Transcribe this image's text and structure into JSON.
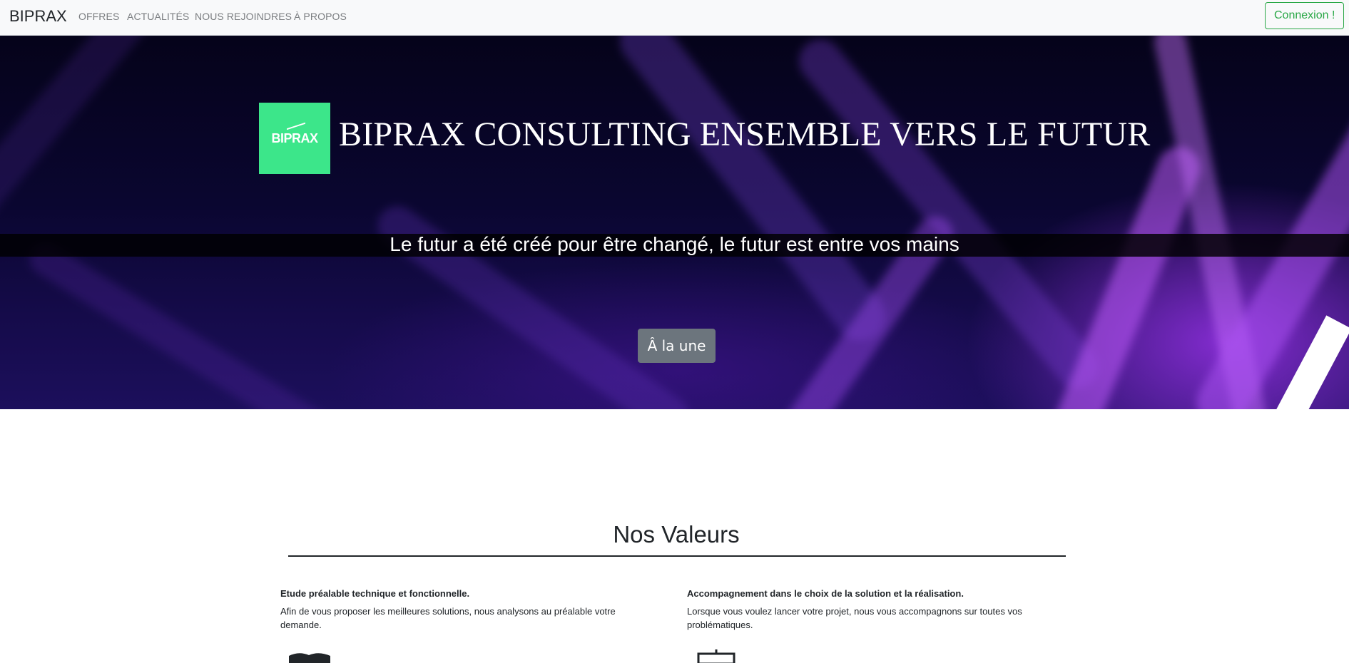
{
  "navbar": {
    "brand": "BIPRAX",
    "links": [
      "OFFRES",
      "ACTUALITÉS",
      "NOUS REJOINDRES",
      "À PROPOS"
    ],
    "login_label": "Connexion !"
  },
  "hero": {
    "logo_text": "BIPRAX",
    "title": "BIPRAX CONSULTING ENSEMBLE VERS LE FUTUR",
    "tagline": "Le futur a été créé pour être changé, le futur est entre vos mains",
    "cta_label": "Â la une"
  },
  "values": {
    "title": "Nos Valeurs",
    "items": [
      {
        "heading": "Etude préalable technique et fonctionnelle.",
        "text": "Afin de vous proposer les meilleures solutions, nous analysons au préalable votre demande.",
        "icon": "book-icon"
      },
      {
        "heading": "Accompagnement dans le choix de la solution et la réalisation.",
        "text": "Lorsque vous voulez lancer votre projet, nous vous accompagnons sur toutes vos problématiques.",
        "icon": "presentation-board-icon"
      }
    ]
  },
  "colors": {
    "accent_green": "#28a745",
    "logo_green": "#3ce68a",
    "button_gray": "#6c757d"
  }
}
